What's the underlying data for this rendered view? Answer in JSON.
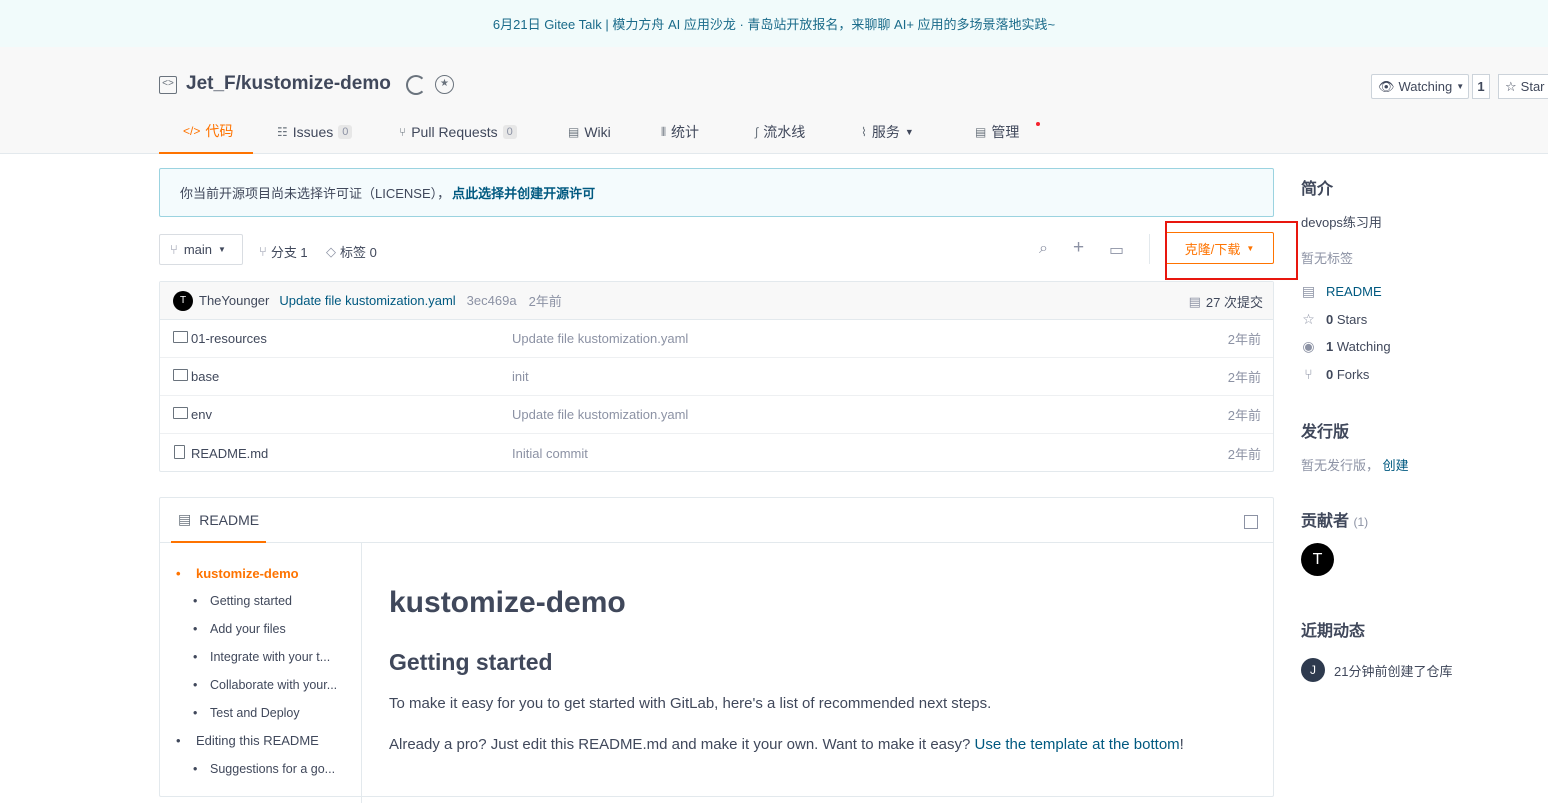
{
  "banner": {
    "text": "6月21日 Gitee Talk | 模力方舟 AI 应用沙龙 · 青岛站开放报名，来聊聊 AI+ 应用的多场景落地实践~"
  },
  "repo": {
    "title": "Jet_F/kustomize-demo",
    "watch_label": "Watching",
    "watch_count": "1",
    "star_label": "Star"
  },
  "tabs": [
    {
      "label": "代码",
      "icon": "code-icon"
    },
    {
      "label": "Issues",
      "count": "0",
      "icon": "issues-icon"
    },
    {
      "label": "Pull Requests",
      "count": "0",
      "icon": "pull-request-icon"
    },
    {
      "label": "Wiki",
      "icon": "wiki-icon"
    },
    {
      "label": "统计",
      "icon": "stats-icon"
    },
    {
      "label": "流水线",
      "icon": "pipeline-icon"
    },
    {
      "label": "服务",
      "icon": "service-icon"
    },
    {
      "label": "管理",
      "icon": "manage-icon"
    }
  ],
  "notice": {
    "text": "你当前开源项目尚未选择许可证（LICENSE），",
    "link": "点此选择并创建开源许可"
  },
  "branch": {
    "name": "main",
    "branches": "分支 1",
    "tags": "标签 0",
    "clone_label": "克隆/下载"
  },
  "commit": {
    "avatar": "T",
    "author": "TheYounger",
    "message": "Update file kustomization.yaml",
    "sha": "3ec469a",
    "time": "2年前",
    "count": "27 次提交"
  },
  "files": [
    {
      "name": "01-resources",
      "type": "folder",
      "message": "Update file kustomization.yaml",
      "time": "2年前"
    },
    {
      "name": "base",
      "type": "folder",
      "message": "init",
      "time": "2年前"
    },
    {
      "name": "env",
      "type": "folder",
      "message": "Update file kustomization.yaml",
      "time": "2年前"
    },
    {
      "name": "README.md",
      "type": "file",
      "message": "Initial commit",
      "time": "2年前"
    }
  ],
  "readme": {
    "tab_label": "README",
    "toc": [
      "kustomize-demo",
      "Getting started",
      "Add your files",
      "Integrate with your t...",
      "Collaborate with your...",
      "Test and Deploy",
      "Editing this README",
      "Suggestions for a go..."
    ],
    "h1": "kustomize-demo",
    "h2": "Getting started",
    "p1": "To make it easy for you to get started with GitLab, here's a list of recommended next steps.",
    "p2": "Already a pro? Just edit this README.md and make it your own. Want to make it easy?",
    "p2_link": "Use the template at the bottom",
    "p2_end": "!"
  },
  "sidebar": {
    "intro_title": "简介",
    "intro_text": "devops练习用",
    "no_tags": "暂无标签",
    "readme_link": "README",
    "stars_count": "0",
    "stars_label": "Stars",
    "watching_count": "1",
    "watching_label": "Watching",
    "forks_count": "0",
    "forks_label": "Forks",
    "release_title": "发行版",
    "release_text": "暂无发行版，",
    "release_link": "创建",
    "contributors_title": "贡献者",
    "contributors_count": "(1)",
    "contributor_avatar": "T",
    "activity_title": "近期动态",
    "activity_avatar": "J",
    "activity_text": "21分钟前创建了仓库"
  },
  "colors": {
    "accent": "#fe7300",
    "link": "#005980",
    "highlight_box": "#e8170e"
  }
}
